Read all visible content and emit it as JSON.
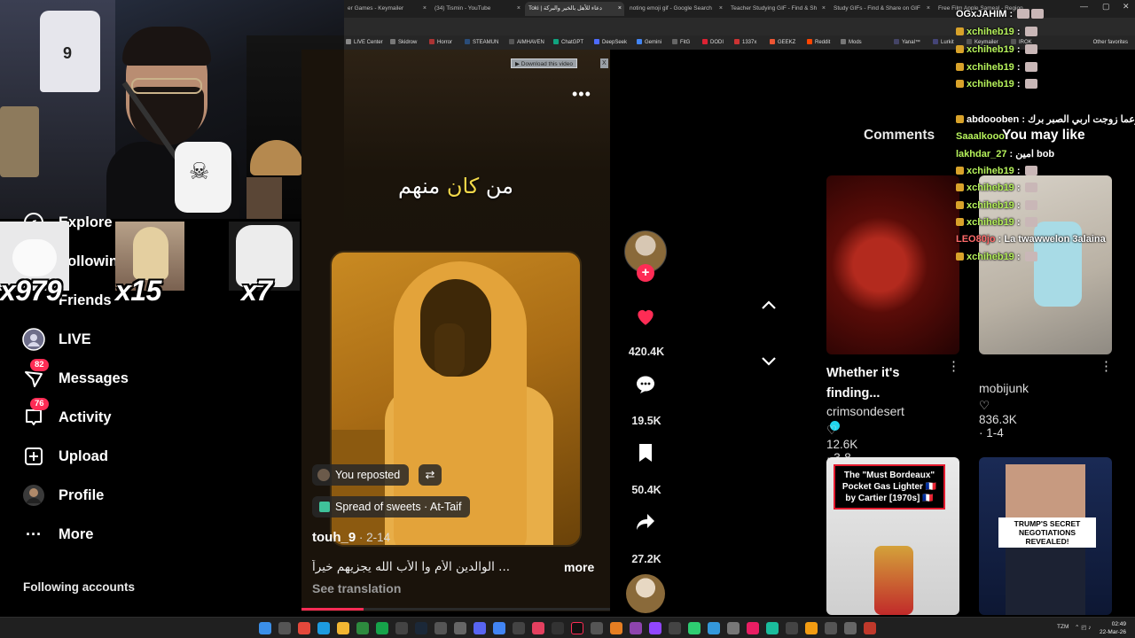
{
  "browser": {
    "tabs": [
      {
        "label": "er Games - Keymailer",
        "active": false
      },
      {
        "label": "(34) Tismin - YouTube",
        "active": false
      },
      {
        "label": "Toki | دعاء للأهل بالخير والبركة",
        "active": true
      },
      {
        "label": "noting emoji gif - Google Search",
        "active": false
      },
      {
        "label": "Teacher Studying GIF - Find & Sh",
        "active": false
      },
      {
        "label": "Study GIFs - Find & Share on GIF",
        "active": false
      },
      {
        "label": "Free Film Apple Sameal - Region",
        "active": false
      }
    ],
    "bookmarks": [
      {
        "label": "LIVE Center",
        "color": "#888"
      },
      {
        "label": "Skidrow",
        "color": "#777"
      },
      {
        "label": "Horror",
        "color": "#a33"
      },
      {
        "label": "STEAMUN",
        "color": "#2a4d7a"
      },
      {
        "label": "AIMHAVEN",
        "color": "#555"
      },
      {
        "label": "ChatGPT",
        "color": "#10a37f"
      },
      {
        "label": "DeepSeek",
        "color": "#4d6bfe"
      },
      {
        "label": "Gemini",
        "color": "#4285f4"
      },
      {
        "label": "FitG",
        "color": "#666"
      },
      {
        "label": "DODI",
        "color": "#d23"
      },
      {
        "label": "1337x",
        "color": "#c33"
      },
      {
        "label": "GEEKZ",
        "color": "#e53"
      },
      {
        "label": "Reddit",
        "color": "#ff4500"
      },
      {
        "label": "Mods",
        "color": "#777"
      },
      {
        "label": "Yanal™",
        "color": "#446"
      },
      {
        "label": "Lurkit",
        "color": "#447"
      },
      {
        "label": "Keymailer",
        "color": "#555"
      },
      {
        "label": "IROK",
        "color": "#555"
      }
    ],
    "other_favorites": "Other favorites",
    "download_video": "▶ Download this video",
    "download_close": "X"
  },
  "nav": {
    "explore": "Explore",
    "following": "Following",
    "friends": "Friends",
    "live": "LIVE",
    "messages": "Messages",
    "messages_badge": "82",
    "activity": "Activity",
    "activity_badge": "76",
    "upload": "Upload",
    "profile": "Profile",
    "more": "More",
    "following_accounts": "Following accounts"
  },
  "emotes": {
    "count1": "x979",
    "count2": "x15",
    "count3": "x7"
  },
  "video": {
    "caption_part1": "من ",
    "caption_highlight": "كان",
    "caption_part2": " منهم",
    "reposted": "You reposted",
    "repost_icon": "repost-icon",
    "location": "Spread of sweets · At-Taif",
    "author": "touh_9",
    "date": " · 2-14",
    "description": "... الوالدين الأم وا الأب الله يجزيهم خيراً",
    "more": "more",
    "see_translation": "See translation",
    "progress": 0.2
  },
  "actions": {
    "likes": "420.4K",
    "comments": "19.5K",
    "saves": "50.4K",
    "shares": "27.2K"
  },
  "panel": {
    "comments_tab": "Comments",
    "may_like_tab": "You may like",
    "cards": [
      {
        "title": "Whether it's finding...",
        "creator": "crimsondesert",
        "verified": true,
        "likes": "12.6K",
        "date": "3-8"
      },
      {
        "title": "",
        "creator": "mobijunk",
        "verified": false,
        "likes": "836.3K",
        "date": "1-4"
      },
      {
        "thumb_text": "The \"Must Bordeaux\" Pocket Gas Lighter 🇫🇷 by Cartier [1970s] 🇫🇷"
      },
      {
        "thumb_text": "TRUMP'S SECRET NEGOTIATIONS REVEALED!"
      }
    ]
  },
  "chat": [
    {
      "user": "OGxJAHIM",
      "text": "",
      "color": "u2"
    },
    {
      "user": "xchiheb19",
      "text": "",
      "color": "u"
    },
    {
      "user": "xchiheb19",
      "text": "",
      "color": "u"
    },
    {
      "user": "xchiheb19",
      "text": "",
      "color": "u"
    },
    {
      "user": "xchiheb19",
      "text": "",
      "color": "u"
    },
    {
      "user": "abdoooben",
      "text": "زعما زوجت اربي الصبر برك",
      "color": "u2"
    },
    {
      "user": "Saaalkooo",
      "text": "",
      "color": "u"
    },
    {
      "user": "lakhdar_27",
      "text": "امين bob",
      "color": "u"
    },
    {
      "user": "xchiheb19",
      "text": "",
      "color": "u"
    },
    {
      "user": "xchiheb19",
      "text": "",
      "color": "u"
    },
    {
      "user": "xchiheb19",
      "text": "",
      "color": "u"
    },
    {
      "user": "xchiheb19",
      "text": "",
      "color": "u"
    },
    {
      "user": "LEO80jo",
      "text": "La twawwelon 3alaina",
      "color": "u3"
    },
    {
      "user": "xchiheb19",
      "text": "",
      "color": "u"
    }
  ],
  "taskbar": {
    "lang": "TZM",
    "time": "02:49",
    "date": "22-Mar-26"
  },
  "colors": {
    "accent": "#fe2c55",
    "bg": "#000000"
  }
}
